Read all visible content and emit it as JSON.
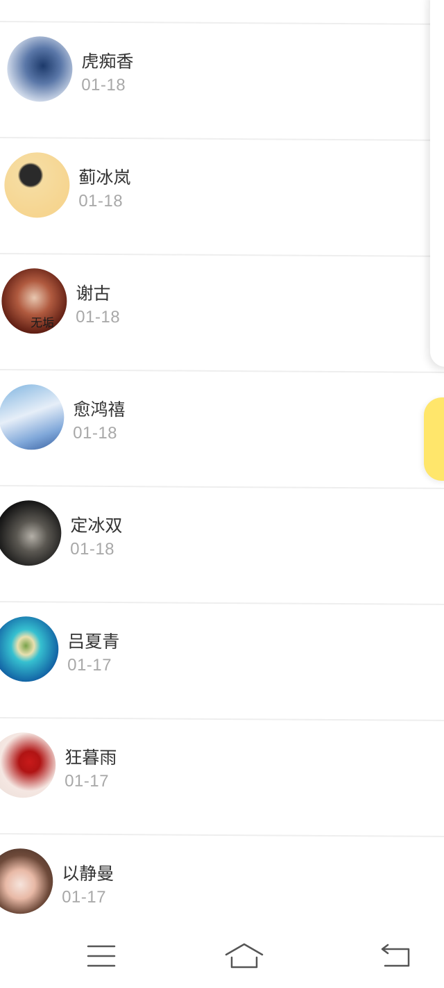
{
  "contacts": [
    {
      "name": "虎痴香",
      "date": "01-18"
    },
    {
      "name": "蓟冰岚",
      "date": "01-18"
    },
    {
      "name": "谢古",
      "date": "01-18"
    },
    {
      "name": "愈鸿禧",
      "date": "01-18"
    },
    {
      "name": "定冰双",
      "date": "01-18"
    },
    {
      "name": "吕夏青",
      "date": "01-17"
    },
    {
      "name": "狂暮雨",
      "date": "01-17"
    },
    {
      "name": "以静曼",
      "date": "01-17"
    }
  ],
  "avatar_overlay_texts": {
    "third": "无垢"
  },
  "navbar": {
    "icons": [
      "menu-icon",
      "home-icon",
      "back-icon"
    ]
  },
  "colors": {
    "accent_yellow": "#ffe66b",
    "name_text": "#333333",
    "date_text": "#a8a8a8",
    "divider": "#eeeeee"
  }
}
